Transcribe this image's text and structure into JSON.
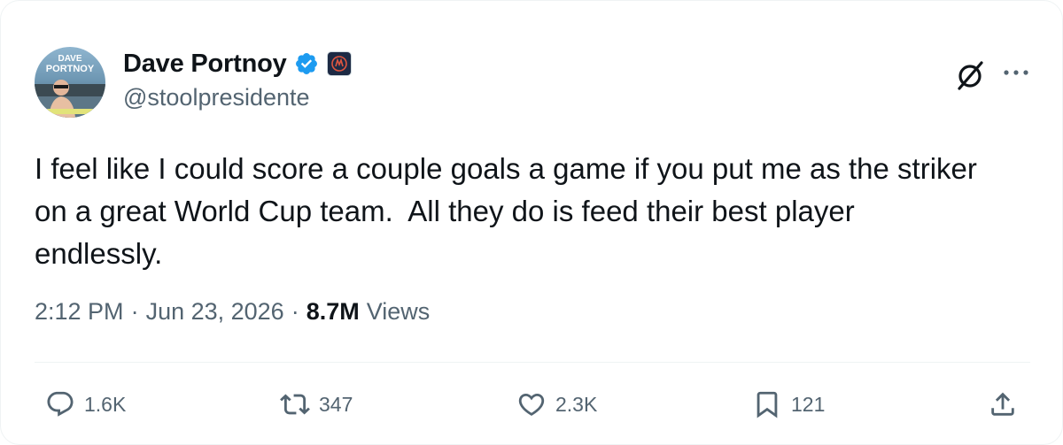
{
  "author": {
    "display_name": "Dave Portnoy",
    "handle": "@stoolpresidente",
    "avatar_text_line1": "DAVE",
    "avatar_text_line2": "PORTNOY",
    "verified": true
  },
  "tweet": {
    "text": "I feel like I could score a couple goals a game if you put me as the striker\non a great World Cup team.  All they do is feed their best player\nendlessly."
  },
  "meta": {
    "time": "2:12 PM",
    "separator": "·",
    "date": "Jun 23, 2026",
    "views_count": "8.7M",
    "views_label": "Views"
  },
  "actions": {
    "replies": "1.6K",
    "reposts": "347",
    "likes": "2.3K",
    "bookmarks": "121"
  },
  "icons": {
    "verified": "verified-badge-icon",
    "affiliate": "affiliate-badge-icon",
    "grok": "grok-icon",
    "more": "more-icon",
    "reply": "reply-icon",
    "repost": "repost-icon",
    "like": "heart-icon",
    "bookmark": "bookmark-icon",
    "share": "share-icon"
  },
  "colors": {
    "text_primary": "#0f1419",
    "text_secondary": "#536471",
    "verified_blue": "#1d9bf0",
    "divider": "#eff3f4"
  }
}
